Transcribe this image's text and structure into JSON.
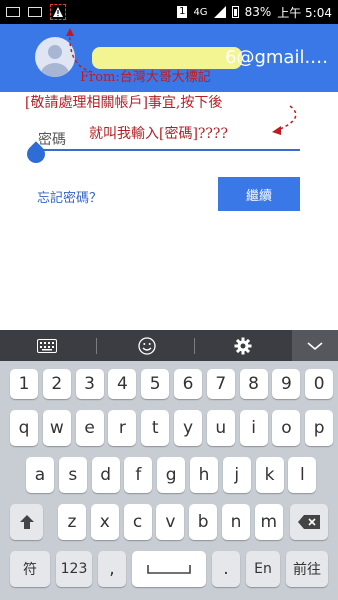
{
  "status_bar": {
    "left_icons": [
      "keyboard-icon",
      "image-icon",
      "warning-icon"
    ],
    "sim": "1",
    "network": "4G",
    "battery_percent": "83%",
    "time": "上午 5:04"
  },
  "header": {
    "email": "6@gmail.…",
    "avatar_icon": "account-circle-icon",
    "background_color": "#3b78e7"
  },
  "annotations": {
    "from": "From:台灣大哥大標記",
    "note1": "[敬請處理相關帳戶]事宜,按下後",
    "note2": "就叫我輸入[密碼]????"
  },
  "form": {
    "password_label": "密碼",
    "forgot_password": "忘記密碼？",
    "continue": "繼續"
  },
  "keyboard": {
    "toolbar": [
      "keyboard-icon",
      "emoji-icon",
      "settings-icon",
      "chevron-down-icon"
    ],
    "row1": [
      "1",
      "2",
      "3",
      "4",
      "5",
      "6",
      "7",
      "8",
      "9",
      "0"
    ],
    "row2": [
      "q",
      "w",
      "e",
      "r",
      "t",
      "y",
      "u",
      "i",
      "o",
      "p"
    ],
    "row3": [
      "a",
      "s",
      "d",
      "f",
      "g",
      "h",
      "j",
      "k",
      "l"
    ],
    "row4": [
      "z",
      "x",
      "c",
      "v",
      "b",
      "n",
      "m"
    ],
    "symbols_key": "符",
    "numbers_key": "123",
    "comma_key": ",",
    "period_key": ".",
    "language_key": "En",
    "next_key": "前往"
  }
}
